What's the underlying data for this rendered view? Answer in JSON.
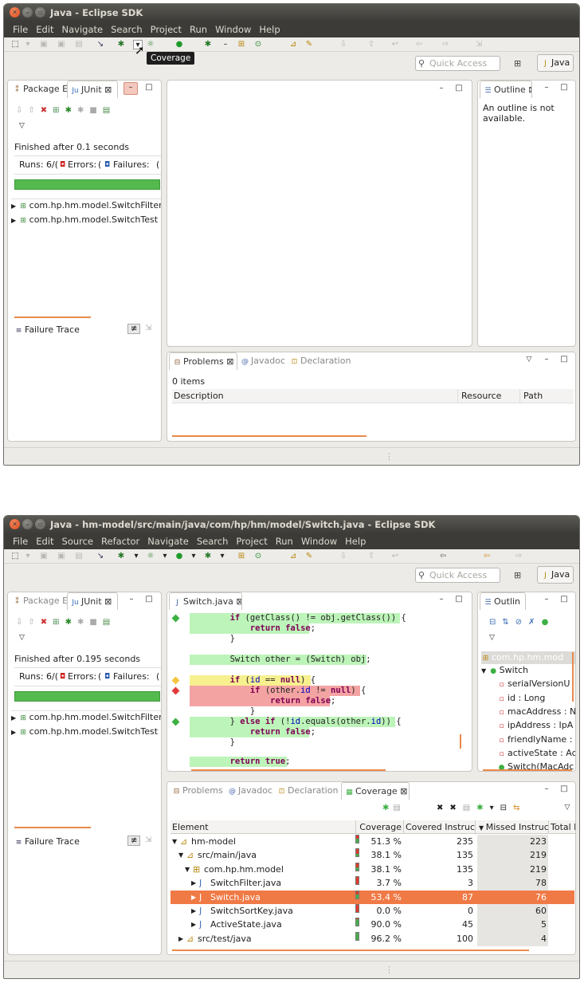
{
  "window1": {
    "title": "Java - Eclipse SDK",
    "menu": [
      "File",
      "Edit",
      "Navigate",
      "Search",
      "Project",
      "Run",
      "Window",
      "Help"
    ],
    "tooltip": "Coverage",
    "quick_access_placeholder": "Quick Access",
    "perspective_label": "Java",
    "left_tabs": [
      "Package E",
      "JUnit"
    ],
    "junit": {
      "finished": "Finished after 0.1 seconds",
      "runs_label": "Runs:",
      "runs_value": "6/(",
      "errors_label": "Errors:",
      "errors_value": "(",
      "failures_label": "Failures:",
      "failures_value": "(",
      "tests": [
        "com.hp.hm.model.SwitchFilter'",
        "com.hp.hm.model.SwitchTest ["
      ],
      "failure_trace": "Failure Trace"
    },
    "outline": {
      "tab": "Outline",
      "message": "An outline is not available."
    },
    "bottom_tabs": [
      "Problems",
      "Javadoc",
      "Declaration"
    ],
    "problems": {
      "count": "0 items",
      "columns": [
        "Description",
        "Resource",
        "Path"
      ]
    }
  },
  "window2": {
    "title": "Java - hm-model/src/main/java/com/hp/hm/model/Switch.java - Eclipse SDK",
    "menu": [
      "File",
      "Edit",
      "Source",
      "Refactor",
      "Navigate",
      "Search",
      "Project",
      "Run",
      "Window",
      "Help"
    ],
    "quick_access_placeholder": "Quick Access",
    "perspective_label": "Java",
    "left_tabs": [
      "Package E",
      "JUnit"
    ],
    "junit": {
      "finished": "Finished after 0.195 seconds",
      "runs_label": "Runs:",
      "runs_value": "6/(",
      "errors_label": "Errors:",
      "errors_value": "(",
      "failures_label": "Failures:",
      "failures_value": "(",
      "tests": [
        "com.hp.hm.model.SwitchFilter'",
        "com.hp.hm.model.SwitchTest ["
      ],
      "failure_trace": "Failure Trace"
    },
    "editor_tab": "Switch.java",
    "outline": {
      "tab": "Outlin",
      "items": [
        "com.hp.hm.mod",
        "Switch",
        "serialVersionU",
        "id : Long",
        "macAddress : N",
        "ipAddress : IpA",
        "friendlyName :",
        "activeState : Ac",
        "Switch(MacAdc"
      ]
    },
    "bottom_tabs": [
      "Problems",
      "Javadoc",
      "Declaration",
      "Coverage"
    ],
    "coverage": {
      "columns": [
        "Element",
        "Coverage",
        "Covered Instruct",
        "Missed Instruc",
        "Total I"
      ],
      "rows": [
        {
          "element": "hm-model",
          "coverage": "51.3 %",
          "covered": "235",
          "missed": "223",
          "ratio": 0.513
        },
        {
          "element": "src/main/java",
          "coverage": "38.1 %",
          "covered": "135",
          "missed": "219",
          "ratio": 0.381
        },
        {
          "element": "com.hp.hm.model",
          "coverage": "38.1 %",
          "covered": "135",
          "missed": "219",
          "ratio": 0.381
        },
        {
          "element": "SwitchFilter.java",
          "coverage": "3.7 %",
          "covered": "3",
          "missed": "78",
          "ratio": 0.037
        },
        {
          "element": "Switch.java",
          "coverage": "53.4 %",
          "covered": "87",
          "missed": "76",
          "ratio": 0.534
        },
        {
          "element": "SwitchSortKey.java",
          "coverage": "0.0 %",
          "covered": "0",
          "missed": "60",
          "ratio": 0.0
        },
        {
          "element": "ActiveState.java",
          "coverage": "90.0 %",
          "covered": "45",
          "missed": "5",
          "ratio": 0.9
        },
        {
          "element": "src/test/java",
          "coverage": "96.2 %",
          "covered": "100",
          "missed": "4",
          "ratio": 0.962
        }
      ]
    }
  }
}
